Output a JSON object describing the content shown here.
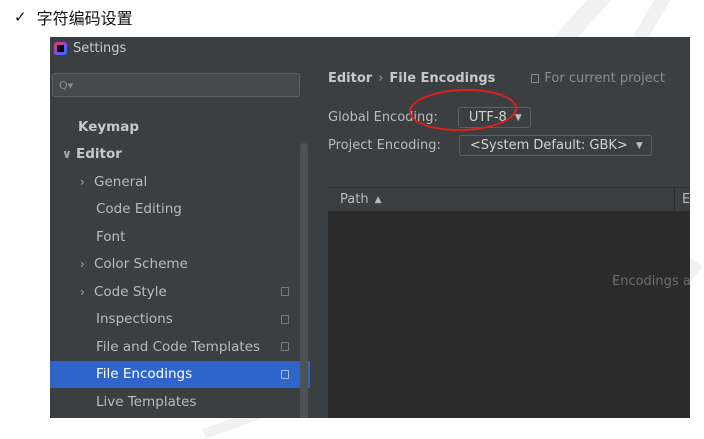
{
  "heading": {
    "check": "✓",
    "text": "字符编码设置"
  },
  "window": {
    "title": "Settings"
  },
  "sidebar": {
    "search_placeholder": "Q▾",
    "items": [
      {
        "label": "Keymap",
        "bold": true
      },
      {
        "label": "Editor",
        "bold": true,
        "chevron": "∨"
      },
      {
        "label": "General",
        "chevron": "›"
      },
      {
        "label": "Code Editing"
      },
      {
        "label": "Font"
      },
      {
        "label": "Color Scheme",
        "chevron": "›"
      },
      {
        "label": "Code Style",
        "chevron": "›",
        "project_icon": true
      },
      {
        "label": "Inspections",
        "project_icon": true
      },
      {
        "label": "File and Code Templates",
        "project_icon": true
      },
      {
        "label": "File Encodings",
        "project_icon": true,
        "selected": true
      },
      {
        "label": "Live Templates"
      }
    ]
  },
  "main": {
    "breadcrumb": {
      "parent": "Editor",
      "separator": "›",
      "current": "File Encodings",
      "scope": "For current project"
    },
    "global_encoding": {
      "label": "Global Encoding:",
      "value": "UTF-8"
    },
    "project_encoding": {
      "label": "Project Encoding:",
      "value": "<System Default: GBK>"
    },
    "table": {
      "col_path": "Path",
      "sort_icon": "▲",
      "col_encoding": "E",
      "empty_text": "Encodings a"
    }
  },
  "colors": {
    "selected": "#2f65ca",
    "panel": "#3c3f41",
    "table_bg": "#2b2b2b",
    "annotation": "#e0201b"
  }
}
